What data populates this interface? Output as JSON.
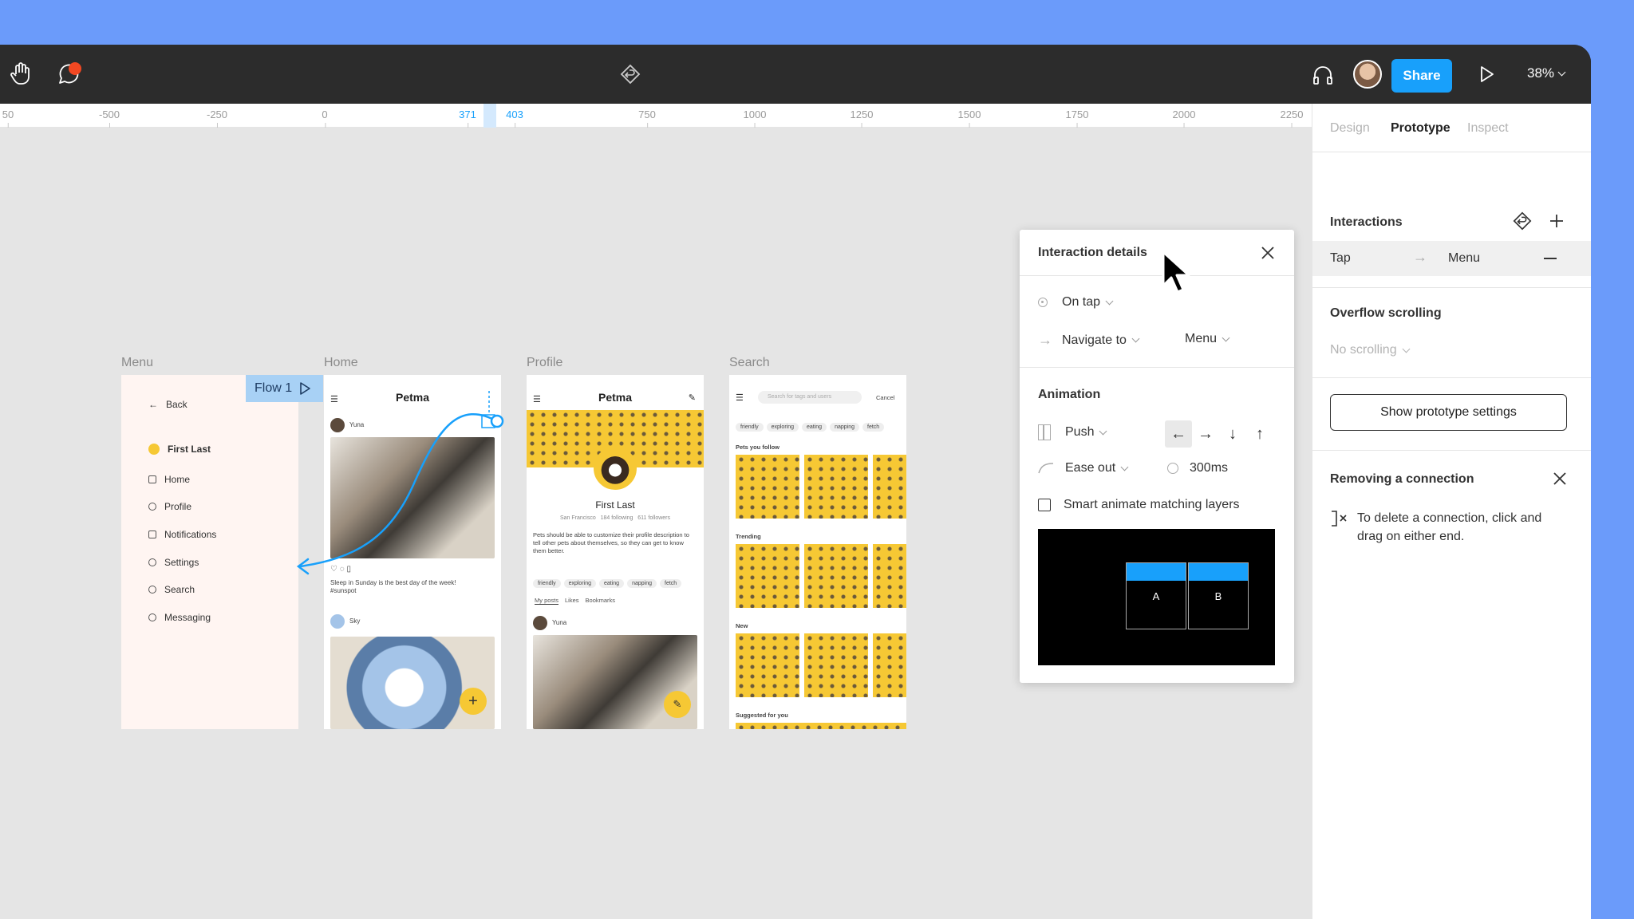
{
  "toolbar": {
    "share_label": "Share",
    "zoom_label": "38%"
  },
  "ruler": {
    "ticks": [
      "50",
      "-500",
      "-250",
      "0",
      "371",
      "403",
      "750",
      "1000",
      "1250",
      "1500",
      "1750",
      "2000",
      "2250"
    ]
  },
  "canvas": {
    "frames": {
      "menu": "Menu",
      "home": "Home",
      "profile": "Profile",
      "search": "Search"
    },
    "flow_label": "Flow 1",
    "menu_frame": {
      "back": "Back",
      "user": "First Last",
      "items": [
        "Home",
        "Profile",
        "Notifications",
        "Settings",
        "Search",
        "Messaging"
      ]
    },
    "home_frame": {
      "title": "Petma",
      "user1": "Yuna",
      "caption": "Sleep in Sunday is the best day of the week! #sunspot",
      "user2": "Sky"
    },
    "profile_frame": {
      "title": "Petma",
      "name": "First Last",
      "meta": "San Francisco   184 following   611 followers",
      "bio": "Pets should be able to customize their profile description to tell other pets about themselves, so they can get to know them better.",
      "chips": [
        "friendly",
        "exploring",
        "eating",
        "napping",
        "fetch"
      ],
      "tabs": [
        "My posts",
        "Likes",
        "Bookmarks"
      ],
      "user": "Yuna"
    },
    "search_frame": {
      "placeholder": "Search for tags and users",
      "cancel": "Cancel",
      "chips": [
        "friendly",
        "exploring",
        "eating",
        "napping",
        "fetch"
      ],
      "sections": [
        "Pets you follow",
        "Trending",
        "New",
        "Suggested for you"
      ]
    }
  },
  "interaction_dialog": {
    "title": "Interaction details",
    "trigger": "On tap",
    "action": "Navigate to",
    "destination": "Menu",
    "animation_heading": "Animation",
    "animation_type": "Push",
    "easing": "Ease out",
    "duration": "300ms",
    "smart_animate_label": "Smart animate matching layers",
    "preview": {
      "screen_a": "A",
      "screen_b": "B"
    }
  },
  "right_panel": {
    "tabs": [
      "Design",
      "Prototype",
      "Inspect"
    ],
    "interactions_heading": "Interactions",
    "interaction": {
      "trigger": "Tap",
      "destination": "Menu"
    },
    "overflow_heading": "Overflow scrolling",
    "overflow_value": "No scrolling",
    "settings_button": "Show prototype settings",
    "removing_heading": "Removing a connection",
    "removing_text": "To delete a connection, click and drag on either end."
  },
  "colors": {
    "accent": "#18a0fb",
    "background": "#6b9bfa",
    "notification": "#f24822",
    "pet_yellow": "#f6c834"
  }
}
